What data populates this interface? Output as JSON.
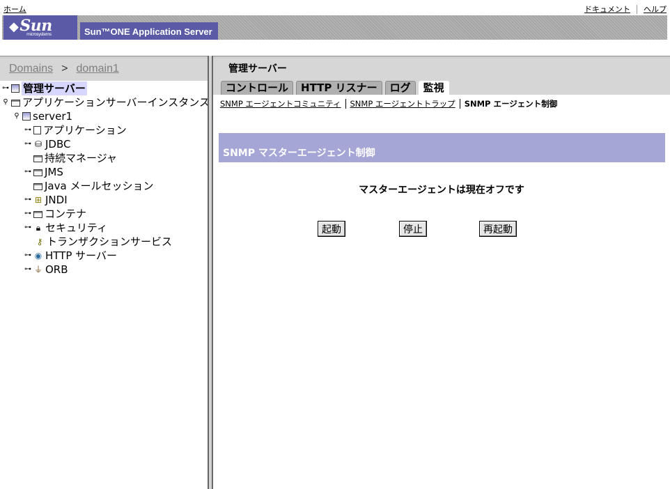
{
  "masthead": {
    "home_link": "ホーム",
    "documentation_link": "ドキュメント",
    "help_link": "ヘルプ",
    "logo_text": "Sun",
    "logo_subtext": "microsystems",
    "product_name": "Sun™ONE Application Server"
  },
  "breadcrumb": {
    "root": "Domains",
    "separator": ">",
    "current": "domain1"
  },
  "tree": {
    "items": [
      {
        "label": "管理サーバー",
        "toggle": "⊶",
        "icon": "server-icon"
      },
      {
        "label": "アプリケーションサーバーインスタンス",
        "toggle": "⚲",
        "icon": "folder-icon"
      },
      {
        "label": "server1",
        "toggle": "⚲",
        "icon": "server-icon"
      },
      {
        "label": "アプリケーション",
        "toggle": "⊶",
        "icon": "document-icon"
      },
      {
        "label": "JDBC",
        "toggle": "⊶",
        "icon": "database-icon"
      },
      {
        "label": "持続マネージャ",
        "toggle": "",
        "icon": "folder-icon"
      },
      {
        "label": "JMS",
        "toggle": "⊶",
        "icon": "folder-icon"
      },
      {
        "label": "Java メールセッション",
        "toggle": "",
        "icon": "folder-icon"
      },
      {
        "label": "JNDI",
        "toggle": "⊶",
        "icon": "jndi-icon"
      },
      {
        "label": "コンテナ",
        "toggle": "⊶",
        "icon": "folder-icon"
      },
      {
        "label": "セキュリティ",
        "toggle": "⊶",
        "icon": "lock-icon"
      },
      {
        "label": "トランザクションサービス",
        "toggle": "",
        "icon": "key-icon"
      },
      {
        "label": "HTTP サーバー",
        "toggle": "⊶",
        "icon": "globe-icon"
      },
      {
        "label": "ORB",
        "toggle": "⊶",
        "icon": "plug-icon"
      }
    ]
  },
  "page": {
    "title": "管理サーバー",
    "tabs": [
      {
        "label": "コントロール"
      },
      {
        "label": "HTTP リスナー"
      },
      {
        "label": "ログ"
      },
      {
        "label": "監視",
        "active": true
      }
    ],
    "subtabs": [
      {
        "label": "SNMP エージェントコミュニティ"
      },
      {
        "label": "SNMP エージェントトラップ"
      },
      {
        "label": "SNMP エージェント制御",
        "current": true
      }
    ],
    "section_title": "SNMP マスターエージェント制御",
    "status_text": "マスターエージェントは現在オフです",
    "buttons": {
      "start": "起動",
      "stop": "停止",
      "restart": "再起動"
    }
  },
  "colors": {
    "banner_blue": "#5a5aa6",
    "section_bar": "#a5a5d6",
    "selected_bg": "#d6d6ff"
  }
}
